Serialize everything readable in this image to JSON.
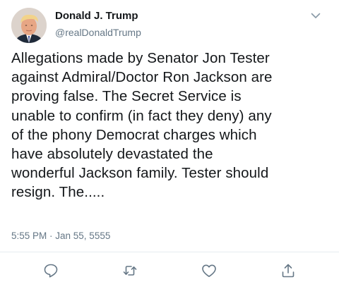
{
  "tweet": {
    "author": {
      "name": "Donald J. Trump",
      "handle": "@realDonaldTrump"
    },
    "text_lines": [
      "Allegations made by Senator Jon Tester",
      "against Admiral/Doctor Ron Jackson are",
      "proving false. The Secret Service is",
      "unable to confirm (in fact they deny) any",
      "of the phony Democrat charges which",
      "have absolutely devastated the",
      "wonderful Jackson family. Tester should",
      "resign. The....."
    ],
    "timestamp": "5:55 PM · Jan 55, 5555"
  },
  "icons": {
    "menu": "chevron-down-icon",
    "reply": "reply-icon",
    "retweet": "retweet-icon",
    "like": "heart-icon",
    "share": "share-icon"
  },
  "colors": {
    "text": "#14171a",
    "secondary": "#657786",
    "divider": "#e6ecf0",
    "icon": "#657786"
  }
}
